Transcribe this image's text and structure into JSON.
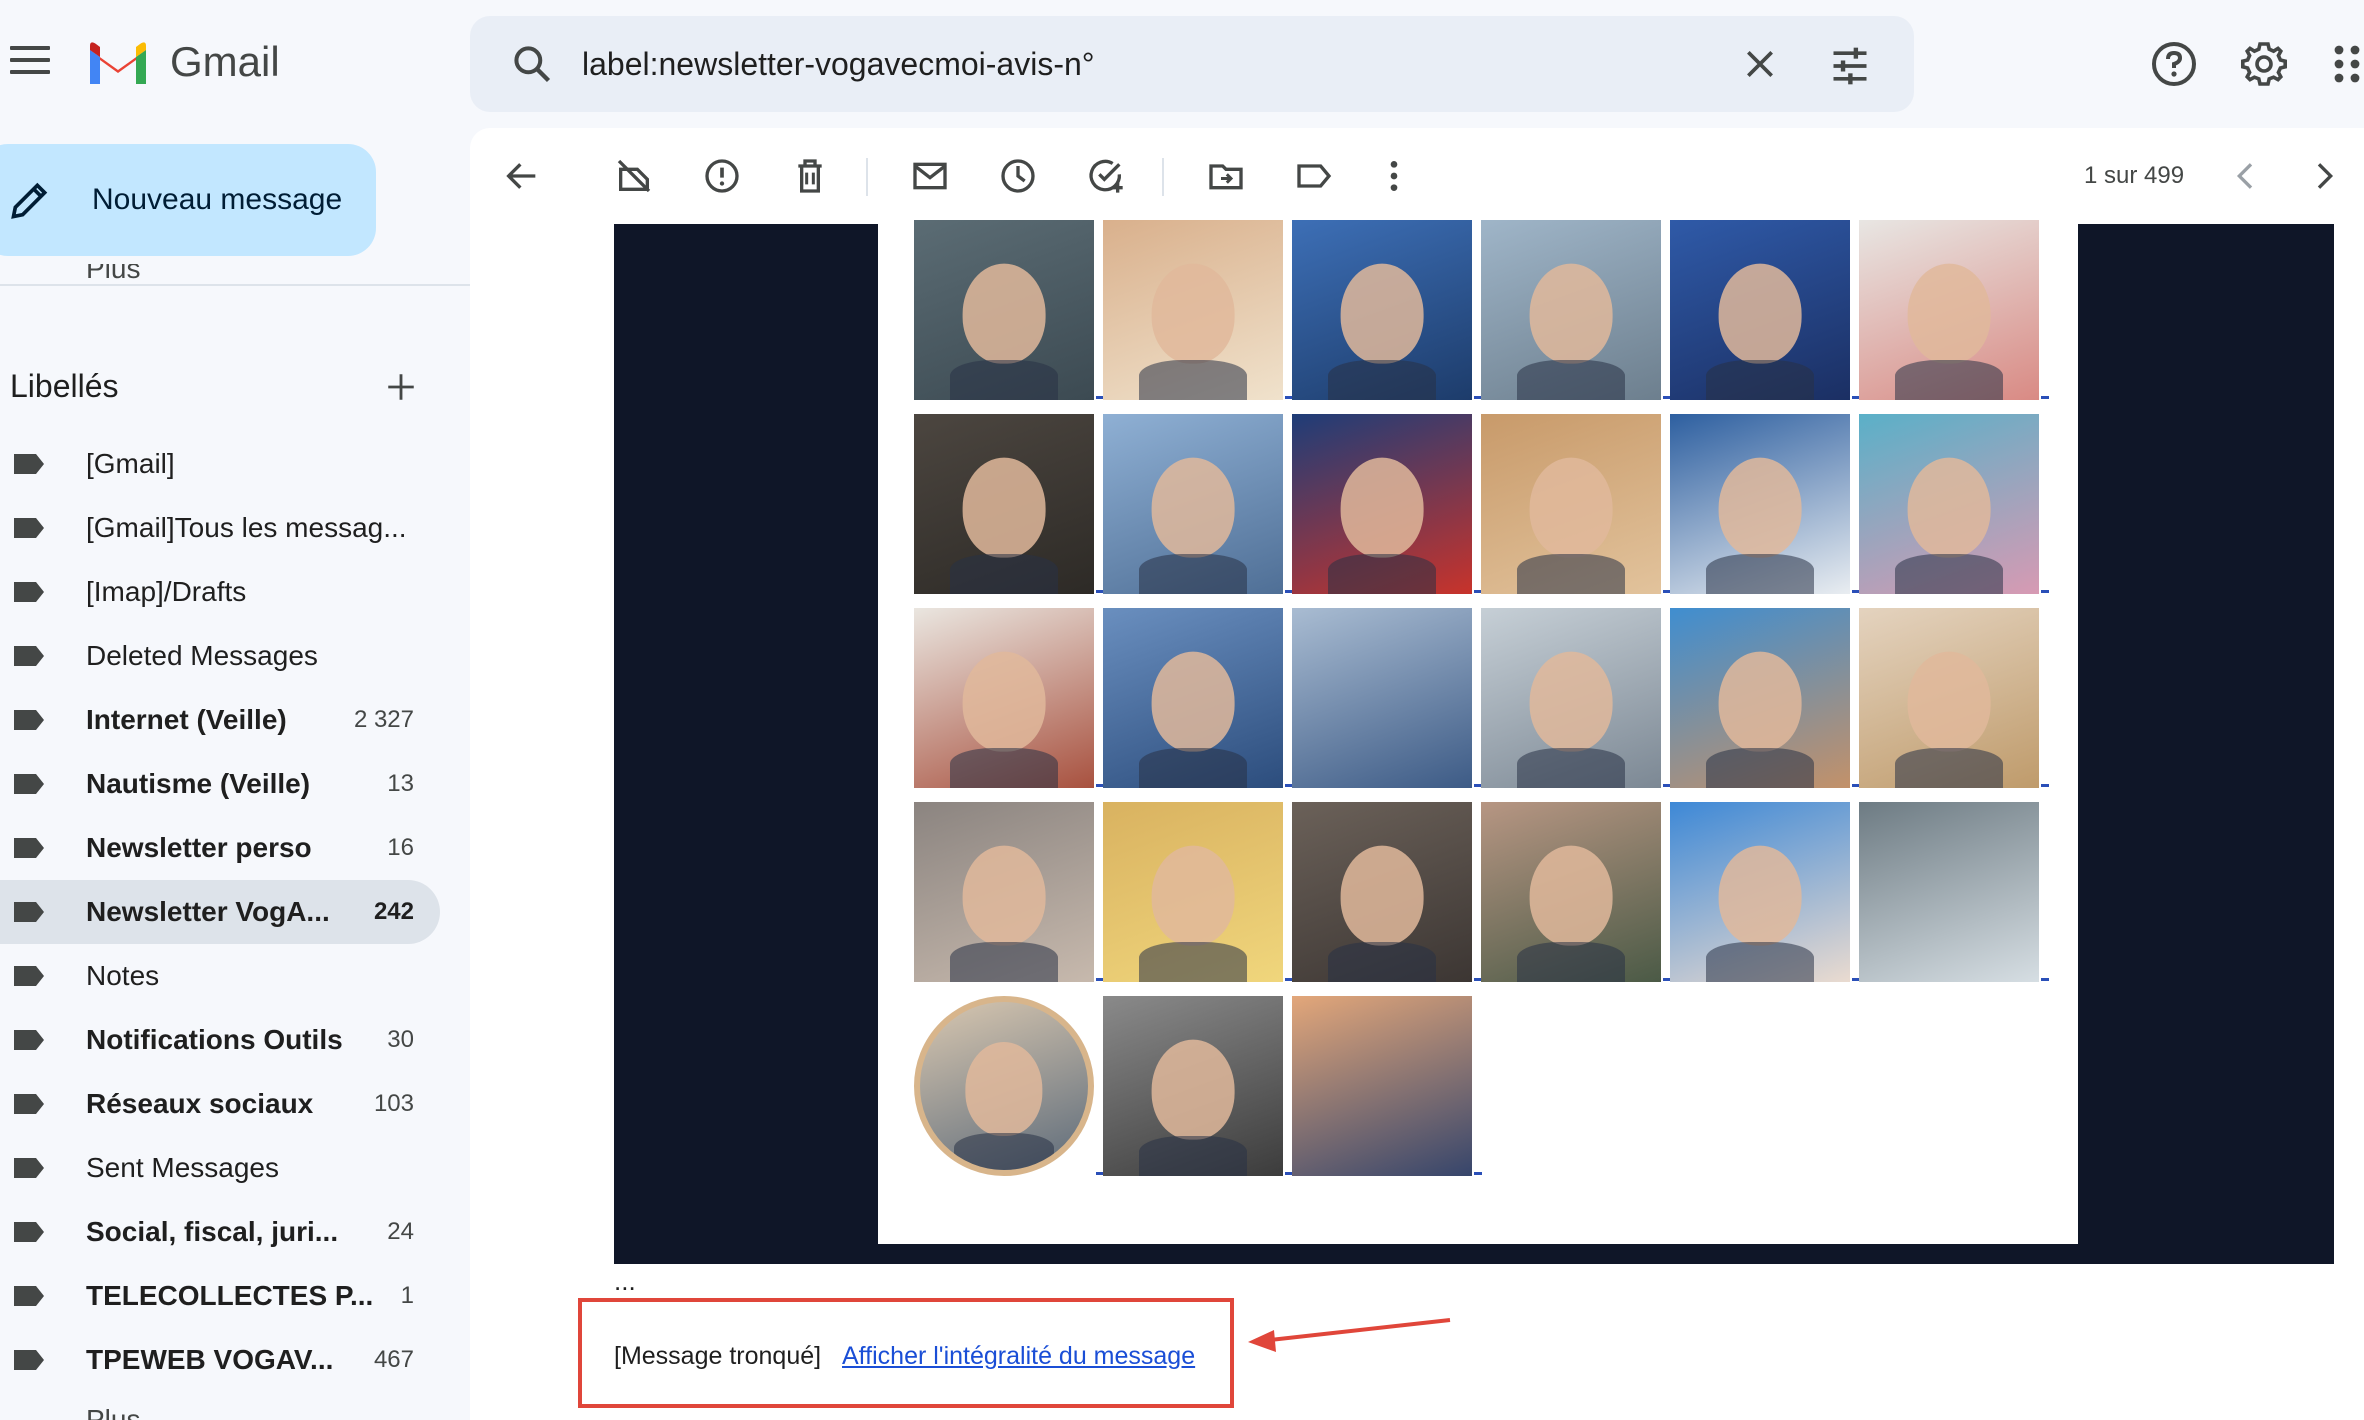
{
  "app": {
    "name": "Gmail"
  },
  "search": {
    "query": "label:newsletter-vogavecmoi-avis-n°"
  },
  "compose": {
    "label": "Nouveau message"
  },
  "sidebar": {
    "more_top": "Plus",
    "labels_heading": "Libellés",
    "labels": [
      {
        "name": "[Gmail]",
        "count": "",
        "bold": false
      },
      {
        "name": "[Gmail]Tous les messag...",
        "count": "",
        "bold": false
      },
      {
        "name": "[Imap]/Drafts",
        "count": "",
        "bold": false
      },
      {
        "name": "Deleted Messages",
        "count": "",
        "bold": false
      },
      {
        "name": "Internet (Veille)",
        "count": "2 327",
        "bold": true
      },
      {
        "name": "Nautisme (Veille)",
        "count": "13",
        "bold": true
      },
      {
        "name": "Newsletter perso",
        "count": "16",
        "bold": true
      },
      {
        "name": "Newsletter VogA...",
        "count": "242",
        "bold": true,
        "active": true
      },
      {
        "name": "Notes",
        "count": "",
        "bold": false
      },
      {
        "name": "Notifications Outils",
        "count": "30",
        "bold": true
      },
      {
        "name": "Réseaux sociaux",
        "count": "103",
        "bold": true
      },
      {
        "name": "Sent Messages",
        "count": "",
        "bold": false
      },
      {
        "name": "Social, fiscal, juri...",
        "count": "24",
        "bold": true
      },
      {
        "name": "TELECOLLECTES P...",
        "count": "1",
        "bold": true
      },
      {
        "name": "TPEWEB VOGAV...",
        "count": "467",
        "bold": true
      }
    ],
    "more_bottom": "Plus"
  },
  "toolbar": {
    "pager": "1 sur 499"
  },
  "email": {
    "ellipsis": "...",
    "truncated_label": "[Message tronqué]",
    "view_full_link": "Afficher l'intégralité du message"
  },
  "colors": {
    "compose_bg": "#c2e7ff",
    "active_label_bg": "#dde3ea",
    "email_dark_bg": "#0f1628",
    "highlight_box": "#e0463a",
    "link": "#1a4ed6"
  }
}
